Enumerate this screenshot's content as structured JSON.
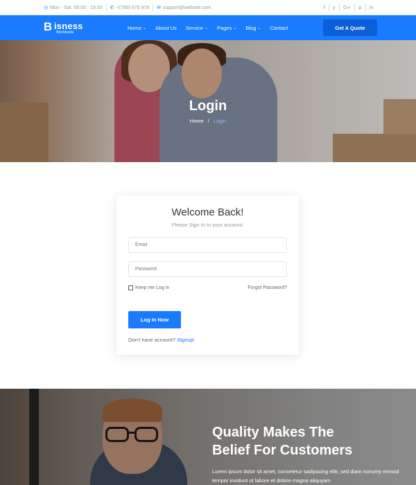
{
  "topbar": {
    "hours": "Mon - Sat, 09.00 - 19.00",
    "phone": "+(789) 675 978",
    "email": "support@website.com",
    "social": [
      "f",
      "y",
      "G+",
      "p",
      "in"
    ]
  },
  "brand": {
    "letter": "B",
    "name": "isness",
    "tagline": "Worldwide"
  },
  "nav": {
    "items": [
      {
        "label": "Home",
        "dropdown": true
      },
      {
        "label": "About Us",
        "dropdown": false
      },
      {
        "label": "Service",
        "dropdown": true
      },
      {
        "label": "Pages",
        "dropdown": true
      },
      {
        "label": "Blog",
        "dropdown": true
      },
      {
        "label": "Contact",
        "dropdown": false
      }
    ],
    "cta": "Get A Quote"
  },
  "hero": {
    "title": "Login",
    "breadcrumb": {
      "home": "Home",
      "separator": "/",
      "current": "Login"
    }
  },
  "login": {
    "title": "Welcome Back!",
    "subtitle": "Please Sign In to your account.",
    "email_placeholder": "Email",
    "password_placeholder": "Password",
    "remember_label": "Keep me Log In",
    "forgot_label": "Forgot Password?",
    "submit_label": "Log In Now",
    "signup_prompt": "Don't have account?",
    "signup_link": "Signup!"
  },
  "feature": {
    "headline_line1": "Quality Makes The",
    "headline_line2": "Belief For Customers",
    "text": "Lorem ipsum dolor sit amet, consetetur sadipscing elitr, sed diam nonumy eirmod tempor invidunt ut labore et dolore magna aliquyam"
  },
  "colors": {
    "primary": "#1a7bff",
    "primary_dark": "#0d5fd6"
  }
}
